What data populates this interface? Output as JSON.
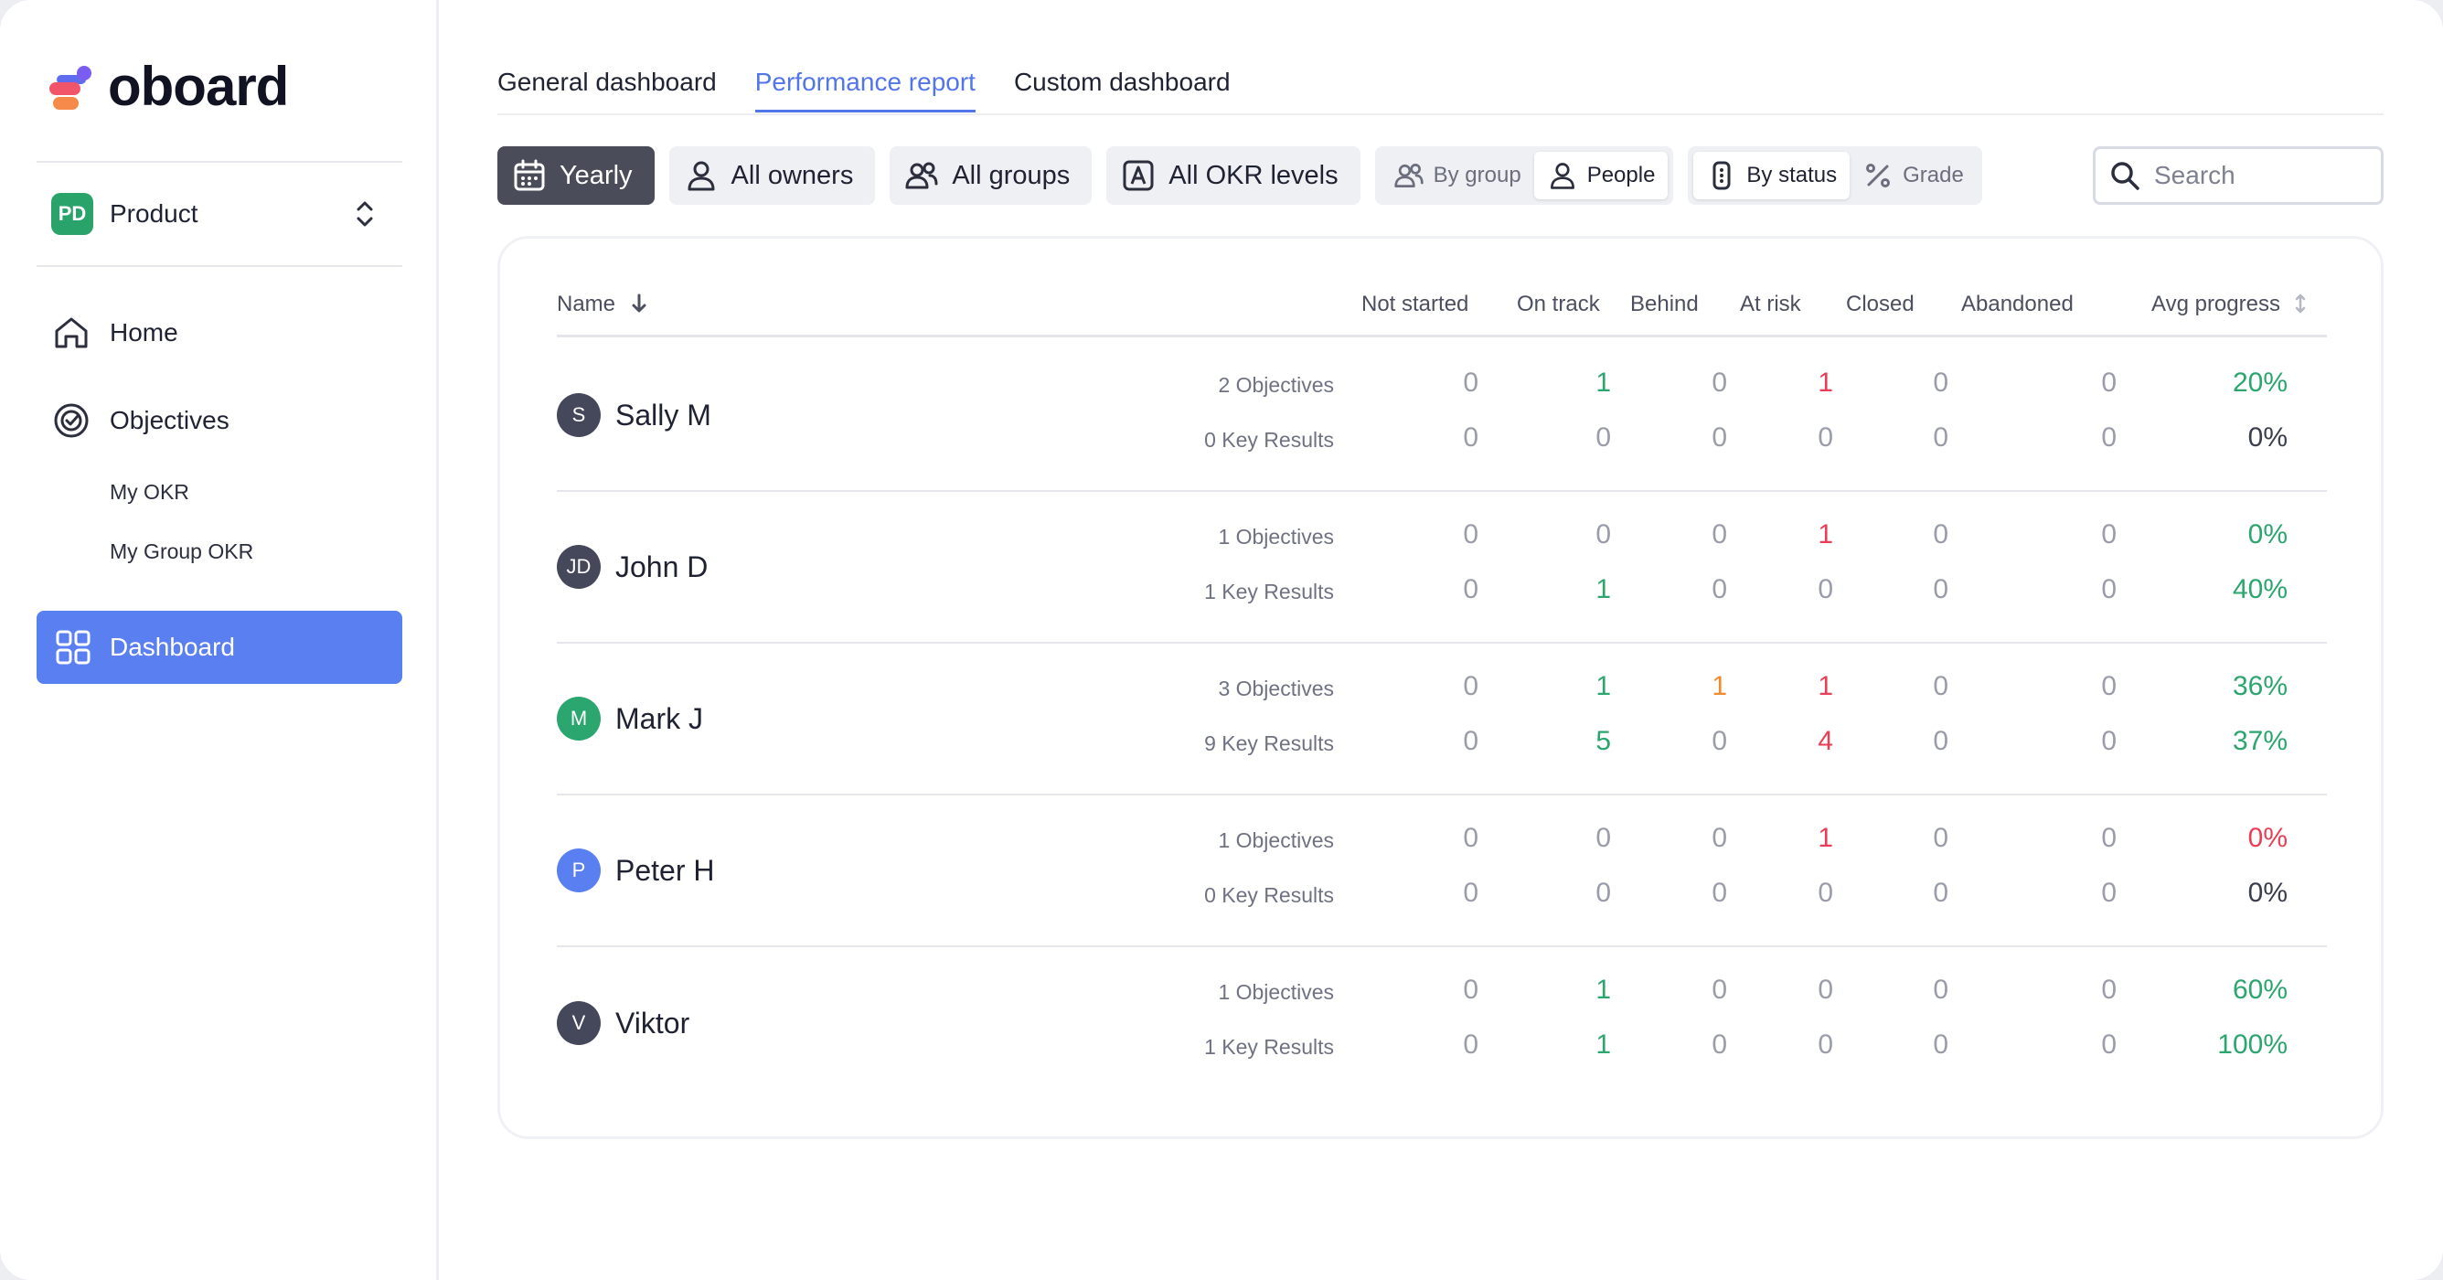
{
  "app": {
    "logo_text": "oboard"
  },
  "sidebar": {
    "workspace": {
      "badge": "PD",
      "name": "Product"
    },
    "items": [
      {
        "label": "Home"
      },
      {
        "label": "Objectives"
      }
    ],
    "sub_items": [
      {
        "label": "My OKR"
      },
      {
        "label": "My Group OKR"
      }
    ],
    "active_item": {
      "label": "Dashboard"
    }
  },
  "tabs": [
    {
      "label": "General dashboard"
    },
    {
      "label": "Performance report"
    },
    {
      "label": "Custom dashboard"
    }
  ],
  "filters": {
    "period": "Yearly",
    "owners": "All owners",
    "groups": "All groups",
    "levels": "All OKR levels",
    "view_by_group": "By group",
    "view_people": "People",
    "by_status": "By status",
    "grade": "Grade"
  },
  "search": {
    "placeholder": "Search"
  },
  "table": {
    "columns": [
      "Name",
      "Not started",
      "On track",
      "Behind",
      "At risk",
      "Closed",
      "Abandoned",
      "Avg progress"
    ],
    "rows": [
      {
        "initials": "S",
        "name": "Sally M",
        "avatar_color": "#45475a",
        "objectives": {
          "label": "2 Objectives",
          "values": [
            "0",
            "1",
            "0",
            "1",
            "0",
            "0"
          ],
          "progress": "20%"
        },
        "key_results": {
          "label": "0 Key Results",
          "values": [
            "0",
            "0",
            "0",
            "0",
            "0",
            "0"
          ],
          "progress": "0%"
        }
      },
      {
        "initials": "JD",
        "name": "John D",
        "avatar_color": "#45475a",
        "objectives": {
          "label": "1 Objectives",
          "values": [
            "0",
            "0",
            "0",
            "1",
            "0",
            "0"
          ],
          "progress": "0%"
        },
        "key_results": {
          "label": "1 Key Results",
          "values": [
            "0",
            "1",
            "0",
            "0",
            "0",
            "0"
          ],
          "progress": "40%"
        }
      },
      {
        "initials": "M",
        "name": "Mark J",
        "avatar_color": "#2aa66e",
        "objectives": {
          "label": "3 Objectives",
          "values": [
            "0",
            "1",
            "1",
            "1",
            "0",
            "0"
          ],
          "progress": "36%"
        },
        "key_results": {
          "label": "9 Key Results",
          "values": [
            "0",
            "5",
            "0",
            "4",
            "0",
            "0"
          ],
          "progress": "37%"
        }
      },
      {
        "initials": "P",
        "name": "Peter H",
        "avatar_color": "#5a7ff0",
        "objectives": {
          "label": "1 Objectives",
          "values": [
            "0",
            "0",
            "0",
            "1",
            "0",
            "0"
          ],
          "progress": "0%"
        },
        "key_results": {
          "label": "0 Key Results",
          "values": [
            "0",
            "0",
            "0",
            "0",
            "0",
            "0"
          ],
          "progress": "0%"
        }
      },
      {
        "initials": "V",
        "name": "Viktor",
        "avatar_color": "#45475a",
        "objectives": {
          "label": "1 Objectives",
          "values": [
            "0",
            "1",
            "0",
            "0",
            "0",
            "0"
          ],
          "progress": "60%"
        },
        "key_results": {
          "label": "1 Key Results",
          "values": [
            "0",
            "1",
            "0",
            "0",
            "0",
            "0"
          ],
          "progress": "100%"
        }
      }
    ]
  },
  "colors": {
    "accent": "#5275ea",
    "active_nav": "#5a7ff0",
    "on_track": "#2aa66e",
    "behind": "#f08a2e",
    "at_risk": "#ea3d56",
    "neutral": "#9a9da9"
  }
}
